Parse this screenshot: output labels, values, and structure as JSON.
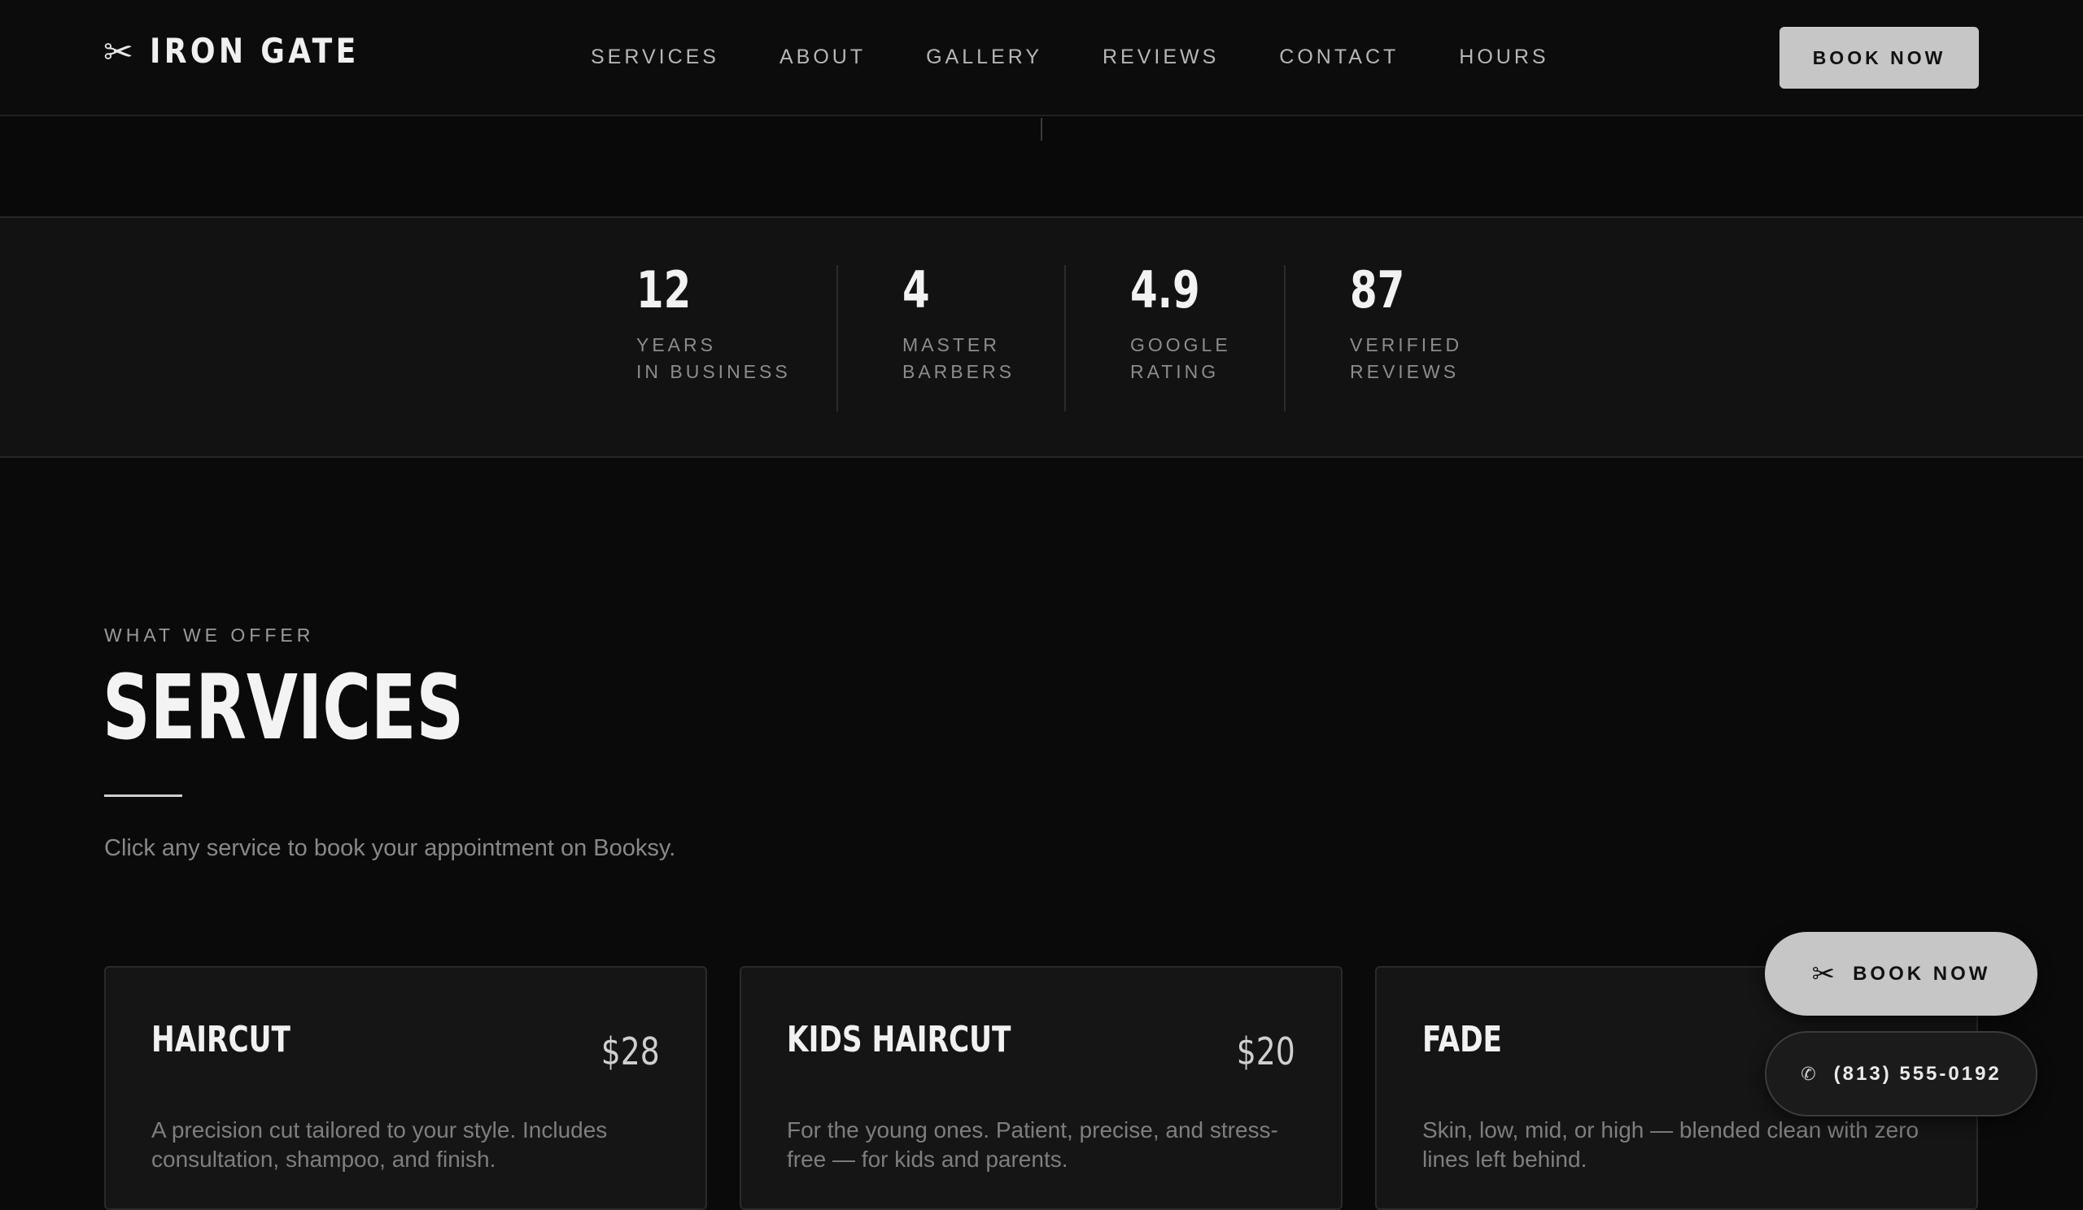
{
  "brand": {
    "name": "IRON GATE",
    "icon": "scissors-icon"
  },
  "nav": {
    "items": [
      {
        "label": "SERVICES"
      },
      {
        "label": "ABOUT"
      },
      {
        "label": "GALLERY"
      },
      {
        "label": "REVIEWS"
      },
      {
        "label": "CONTACT"
      },
      {
        "label": "HOURS"
      }
    ],
    "book_label": "BOOK NOW"
  },
  "stats": [
    {
      "value": "12",
      "line1": "YEARS",
      "line2": "IN BUSINESS"
    },
    {
      "value": "4",
      "line1": "MASTER",
      "line2": "BARBERS"
    },
    {
      "value": "4.9",
      "line1": "GOOGLE",
      "line2": "RATING"
    },
    {
      "value": "87",
      "line1": "VERIFIED",
      "line2": "REVIEWS"
    }
  ],
  "services": {
    "eyebrow": "WHAT WE OFFER",
    "title": "SERVICES",
    "subtitle": "Click any service to book your appointment on Booksy.",
    "cards": [
      {
        "title": "HAIRCUT",
        "price": "$28",
        "description": "A precision cut tailored to your style. Includes consultation, shampoo, and finish."
      },
      {
        "title": "KIDS HAIRCUT",
        "price": "$20",
        "description": "For the young ones. Patient, precise, and stress-free — for kids and parents."
      },
      {
        "title": "FADE",
        "price": "",
        "description": "Skin, low, mid, or high — blended clean with zero lines left behind."
      }
    ]
  },
  "floating": {
    "book_label": "BOOK NOW",
    "phone": "(813) 555-0192",
    "book_icon": "scissors-icon",
    "phone_icon": "phone-icon"
  },
  "colors": {
    "background": "#0a0a0a",
    "panel": "#121212",
    "accent_button": "#c6c6c6",
    "text_primary": "#f0f0f0",
    "text_muted": "#8c8c8c"
  }
}
